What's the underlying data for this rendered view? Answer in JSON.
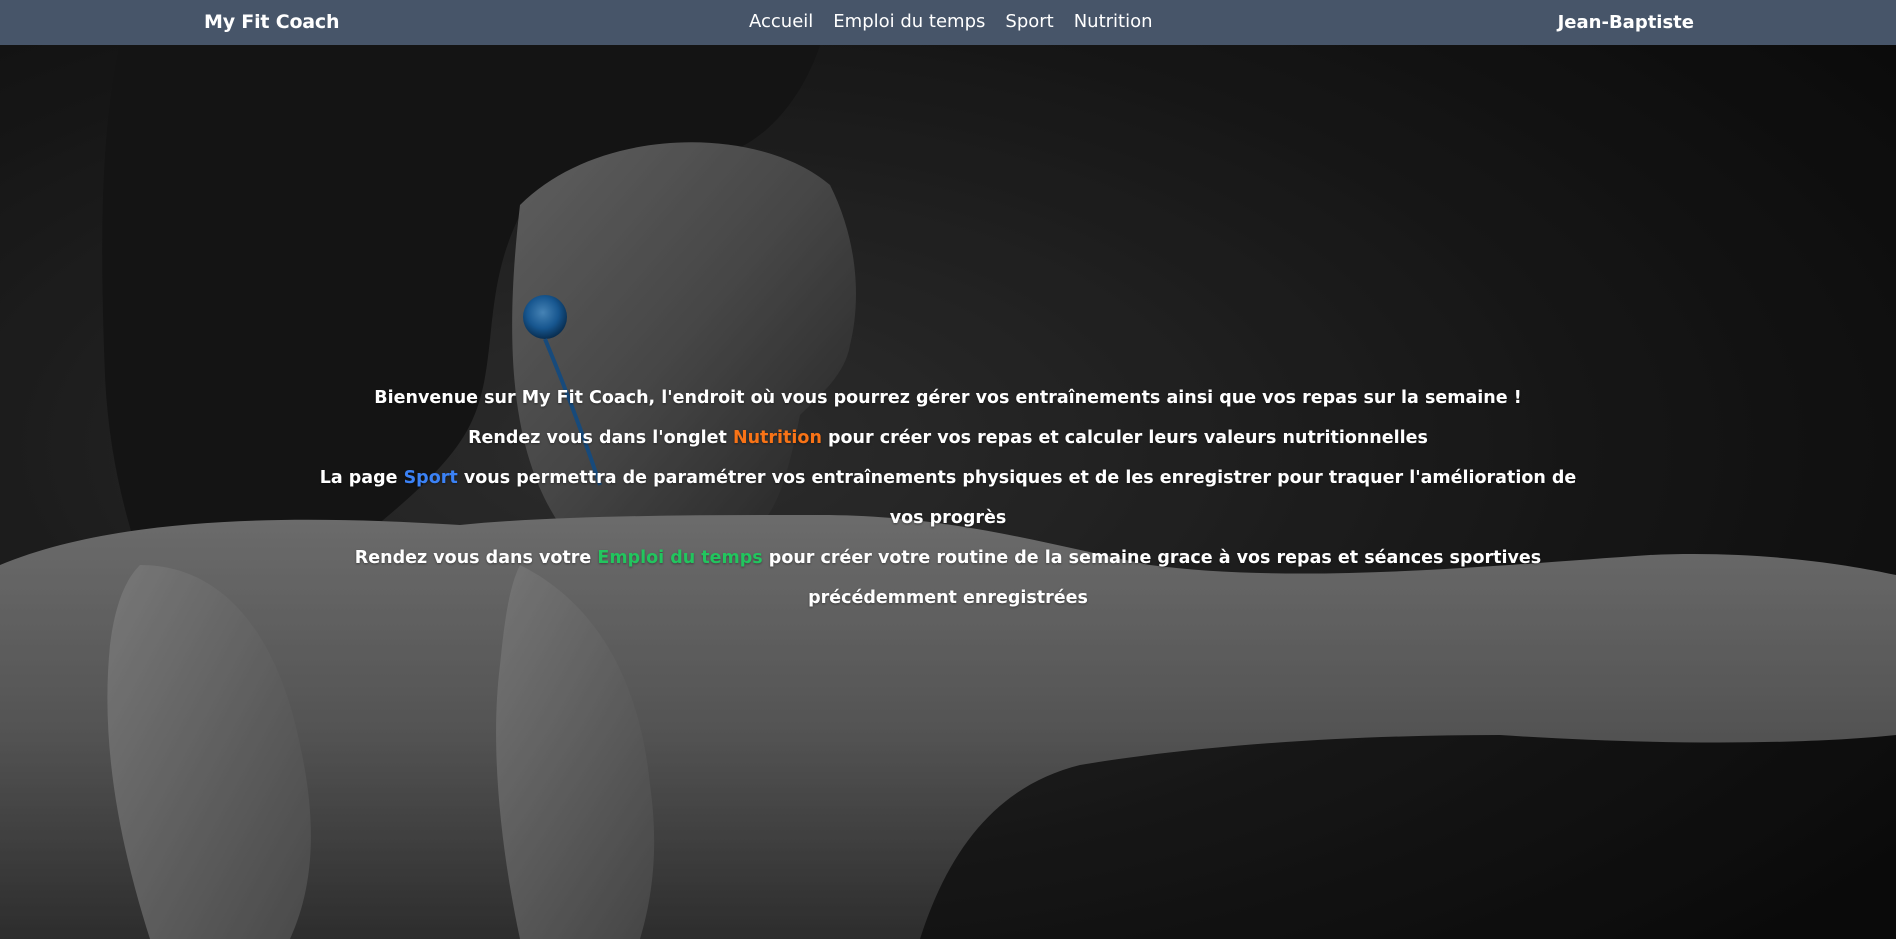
{
  "navbar": {
    "brand": "My Fit Coach",
    "links": [
      "Accueil",
      "Emploi du temps",
      "Sport",
      "Nutrition"
    ],
    "user": "Jean-Baptiste",
    "background": "#475569"
  },
  "hero": {
    "background_image": "black-and-white photo of a woman with ponytail and blue earphone, arm extended",
    "earphone_color": "#1e6fb8",
    "line1": "Bienvenue sur My Fit Coach, l'endroit où vous pourrez gérer vos entraînements ainsi que vos repas sur la semaine !",
    "line2_before": "Rendez vous dans l'onglet ",
    "line2_link": "Nutrition",
    "line2_after": " pour créer vos repas et calculer leurs valeurs nutritionnelles",
    "line3_before": "La page ",
    "line3_link": "Sport",
    "line3_after": " vous permettra de paramétrer vos entraînements physiques et de les enregistrer pour traquer l'amélioration de vos progrès",
    "line4_before": "Rendez vous dans votre ",
    "line4_link": "Emploi du temps",
    "line4_after": " pour créer votre routine de la semaine grace à vos repas et séances sportives précédemment enregistrées",
    "colors": {
      "nutrition": "#f97316",
      "sport": "#3b82f6",
      "emploi": "#22c55e"
    }
  }
}
